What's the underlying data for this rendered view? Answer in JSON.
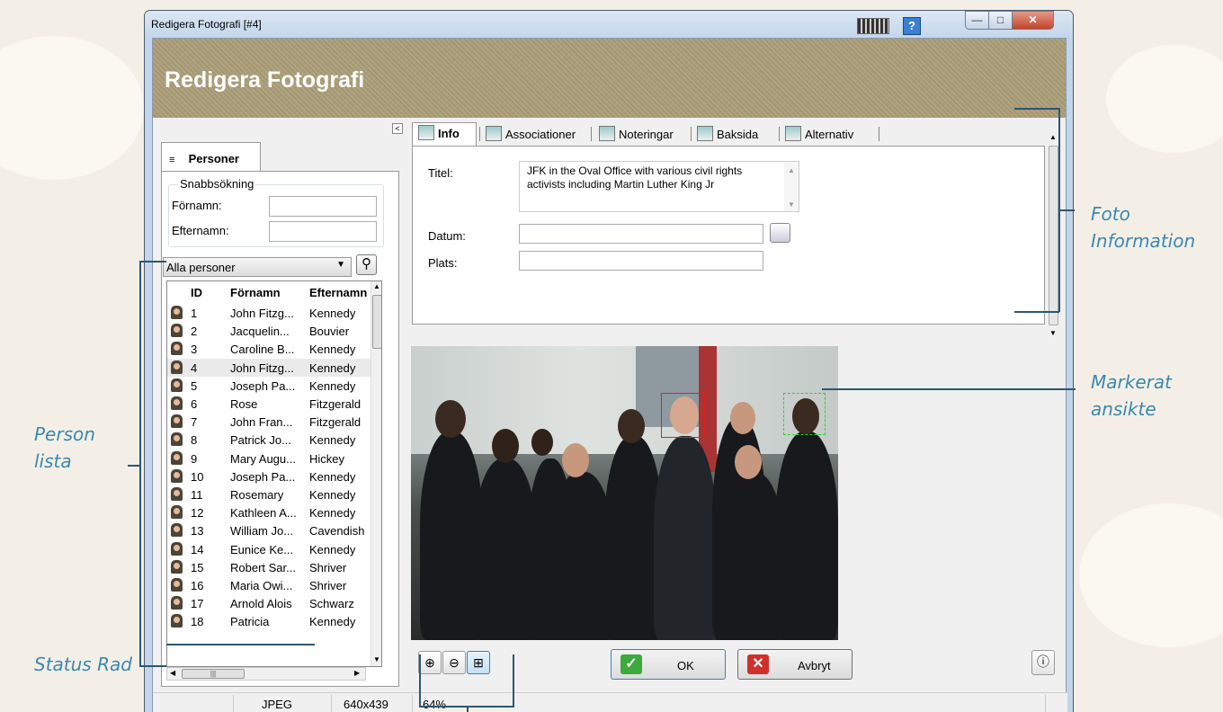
{
  "annotations": {
    "foto_information": [
      "Foto",
      "Information"
    ],
    "markerat_ansikte": [
      "Markerat",
      "ansikte"
    ],
    "person_lista": [
      "Person",
      "lista"
    ],
    "status_rad": "Status Rad"
  },
  "window": {
    "title": "Redigera Fotografi [#4]",
    "help": "?",
    "banner_title": "Redigera Fotografi"
  },
  "left": {
    "collapse": "<",
    "tab_label": "Personer",
    "quick_legend": "Snabbsökning",
    "firstname_label": "Förnamn:",
    "lastname_label": "Efternamn:",
    "firstname_value": "",
    "lastname_value": "",
    "filter_selected": "Alla personer",
    "columns": [
      "ID",
      "Förnamn",
      "Efternamn"
    ],
    "rows": [
      [
        "1",
        "John Fitzg...",
        "Kennedy"
      ],
      [
        "2",
        "Jacquelin...",
        "Bouvier"
      ],
      [
        "3",
        "Caroline B...",
        "Kennedy"
      ],
      [
        "4",
        "John Fitzg...",
        "Kennedy"
      ],
      [
        "5",
        "Joseph Pa...",
        "Kennedy"
      ],
      [
        "6",
        "Rose",
        "Fitzgerald"
      ],
      [
        "7",
        "John Fran...",
        "Fitzgerald"
      ],
      [
        "8",
        "Patrick Jo...",
        "Kennedy"
      ],
      [
        "9",
        "Mary Augu...",
        "Hickey"
      ],
      [
        "10",
        "Joseph Pa...",
        "Kennedy"
      ],
      [
        "11",
        "Rosemary",
        "Kennedy"
      ],
      [
        "12",
        "Kathleen A...",
        "Kennedy"
      ],
      [
        "13",
        "William Jo...",
        "Cavendish"
      ],
      [
        "14",
        "Eunice Ke...",
        "Kennedy"
      ],
      [
        "15",
        "Robert Sar...",
        "Shriver"
      ],
      [
        "16",
        "Maria Owi...",
        "Shriver"
      ],
      [
        "17",
        "Arnold Alois",
        "Schwarz"
      ],
      [
        "18",
        "Patricia",
        "Kennedy"
      ]
    ],
    "selected_row_index": 3
  },
  "tabs": [
    "Info",
    "Associationer",
    "Noteringar",
    "Baksida",
    "Alternativ"
  ],
  "info": {
    "titel_label": "Titel:",
    "titel_value": "JFK in the Oval Office with various civil rights activists including Martin Luther King Jr",
    "datum_label": "Datum:",
    "datum_value": "",
    "plats_label": "Plats:",
    "plats_value": ""
  },
  "buttons": {
    "ok": "OK",
    "cancel": "Avbryt",
    "zoom_in_icon": "zoom-in-icon",
    "zoom_out_icon": "zoom-out-icon",
    "fit_icon": "fit-icon",
    "info_icon": "info-icon"
  },
  "status": {
    "format": "JPEG",
    "size": "640x439",
    "zoom": "64%"
  },
  "colors": {
    "annotation": "#3a88b0",
    "banner": "#ab9d78",
    "face_selected": "#e02020",
    "face_detected": "#30d030"
  }
}
